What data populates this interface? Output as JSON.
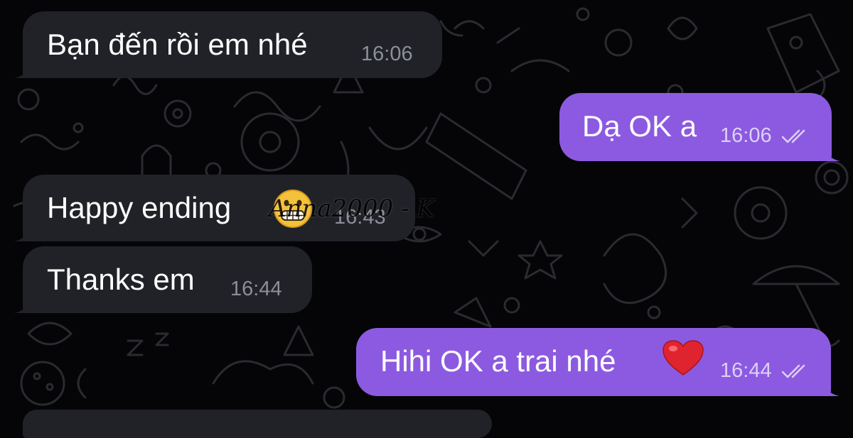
{
  "chat": {
    "messages": [
      {
        "direction": "incoming",
        "text": "Bạn đến rồi em nhé",
        "time": "16:06"
      },
      {
        "direction": "outgoing",
        "text": "Dạ OK a",
        "time": "16:06",
        "status": "read"
      },
      {
        "direction": "incoming",
        "text": "Happy ending",
        "emoji": "grimacing-face",
        "time": "16:43"
      },
      {
        "direction": "incoming",
        "text": "Thanks em",
        "time": "16:44"
      },
      {
        "direction": "outgoing",
        "text": "Hihi OK a trai nhé",
        "emoji": "red-heart",
        "time": "16:44",
        "status": "read"
      }
    ]
  },
  "watermark": {
    "text": "Anna2000 - K"
  },
  "colors": {
    "background": "#050507",
    "incoming_bubble": "#212228",
    "outgoing_bubble": "#8c5ae0",
    "doodle_stroke": "#2a2b31"
  }
}
